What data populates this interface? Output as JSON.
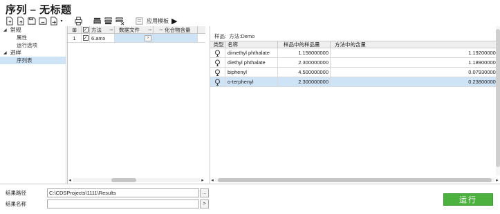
{
  "window": {
    "title": "序列 – 无标题"
  },
  "toolbar": {
    "apply_template_label": "应用模板",
    "icons": [
      "new-icon",
      "open-icon",
      "save-icon",
      "save-as-icon",
      "export-icon",
      "print-icon",
      "insert-row-icon",
      "append-row-icon",
      "delete-row-icon",
      "template-icon",
      "run-arrow-icon"
    ]
  },
  "nav": {
    "groups": [
      {
        "label": "常规",
        "items": [
          "属性",
          "运行选项"
        ]
      },
      {
        "label": "进样",
        "items": [
          "序列表"
        ]
      }
    ],
    "selected": "序列表"
  },
  "sequence_table": {
    "columns": [
      "",
      "",
      "方法",
      "数据文件",
      "化合物含量"
    ],
    "rows": [
      {
        "index": "1",
        "checked": true,
        "method": "6.amx",
        "data_file": "",
        "compound_amount": ""
      }
    ]
  },
  "compound_panel": {
    "sample_label": "样品:",
    "method_label": "方法:Demo",
    "columns": [
      "类型",
      "名称",
      "样品中的样品量",
      "方法中的含量"
    ],
    "rows": [
      {
        "name": "dimethyl  phthalate",
        "sample_amount": "1.158000000",
        "method_amount": "1.192000000",
        "selected": false
      },
      {
        "name": "diethyl phthalate",
        "sample_amount": "2.300000000",
        "method_amount": "1.189000000",
        "selected": false
      },
      {
        "name": "biphenyl",
        "sample_amount": "4.500000000",
        "method_amount": "0.079300000",
        "selected": false
      },
      {
        "name": "o-terphenyl",
        "sample_amount": "2.300000000",
        "method_amount": "0.238000000",
        "selected": true
      }
    ]
  },
  "bottom": {
    "result_path_label": "结果路径",
    "result_path_value": "C:\\CDSProjects\\1111\\Results",
    "result_name_label": "结果名称",
    "result_name_value": "",
    "browse_label": "...",
    "insert_label": ">",
    "run_label": "运行"
  },
  "colors": {
    "run_button": "#4cb13e",
    "selection": "#cfe3f7"
  }
}
